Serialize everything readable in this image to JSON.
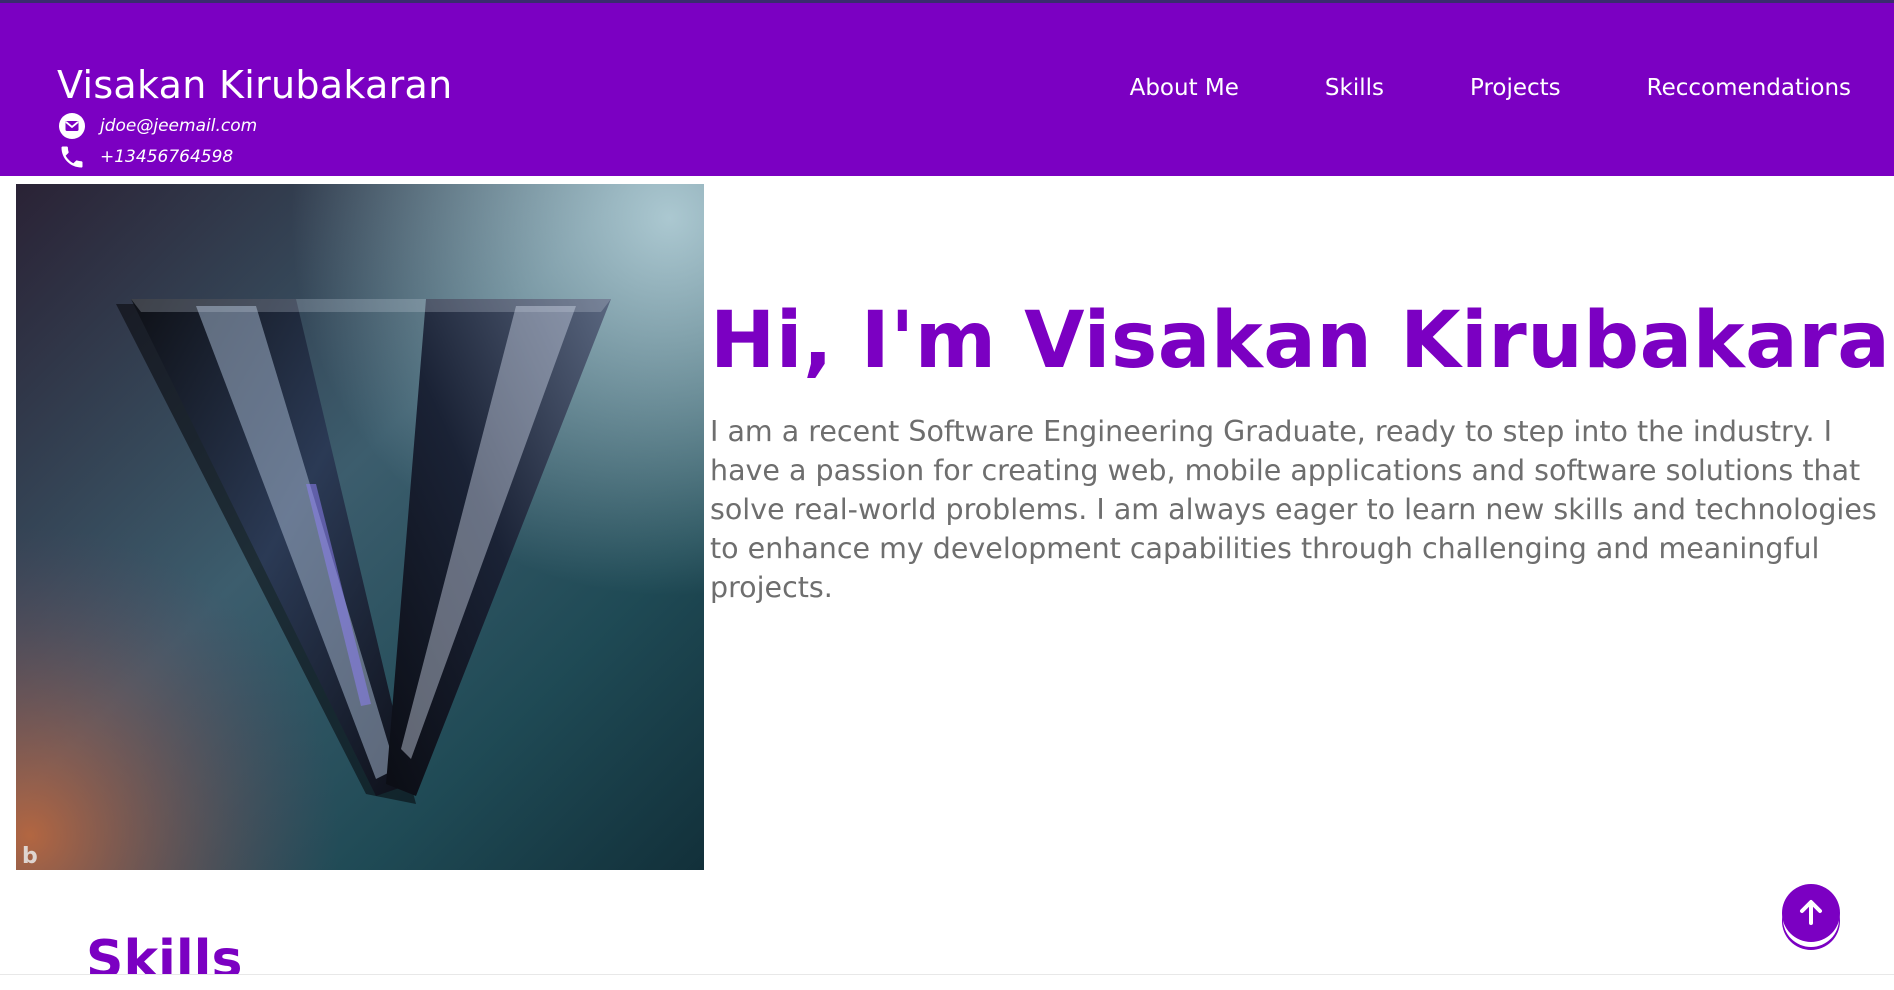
{
  "header": {
    "brand": "Visakan Kirubakaran",
    "email": "jdoe@jeemail.com",
    "phone": "+13456764598",
    "nav": [
      {
        "label": "About Me"
      },
      {
        "label": "Skills"
      },
      {
        "label": "Projects"
      },
      {
        "label": "Reccomendations"
      }
    ]
  },
  "hero": {
    "title": "Hi, I'm Visakan Kirubakaran!",
    "text": "I am a recent Software Engineering Graduate, ready to step into the industry. I have a passion for creating web, mobile applications and software solutions that solve real-world problems. I am always eager to learn new skills and technologies to enhance my development capabilities through challenging and meaningful projects."
  },
  "skills": {
    "title": "Skills"
  },
  "colors": {
    "accent": "#7b00c2",
    "text_muted": "#6e6e6e",
    "background": "#ffffff"
  },
  "icons": {
    "email": "email-icon",
    "phone": "phone-icon",
    "scroll_top": "arrow-up-circle-icon"
  }
}
